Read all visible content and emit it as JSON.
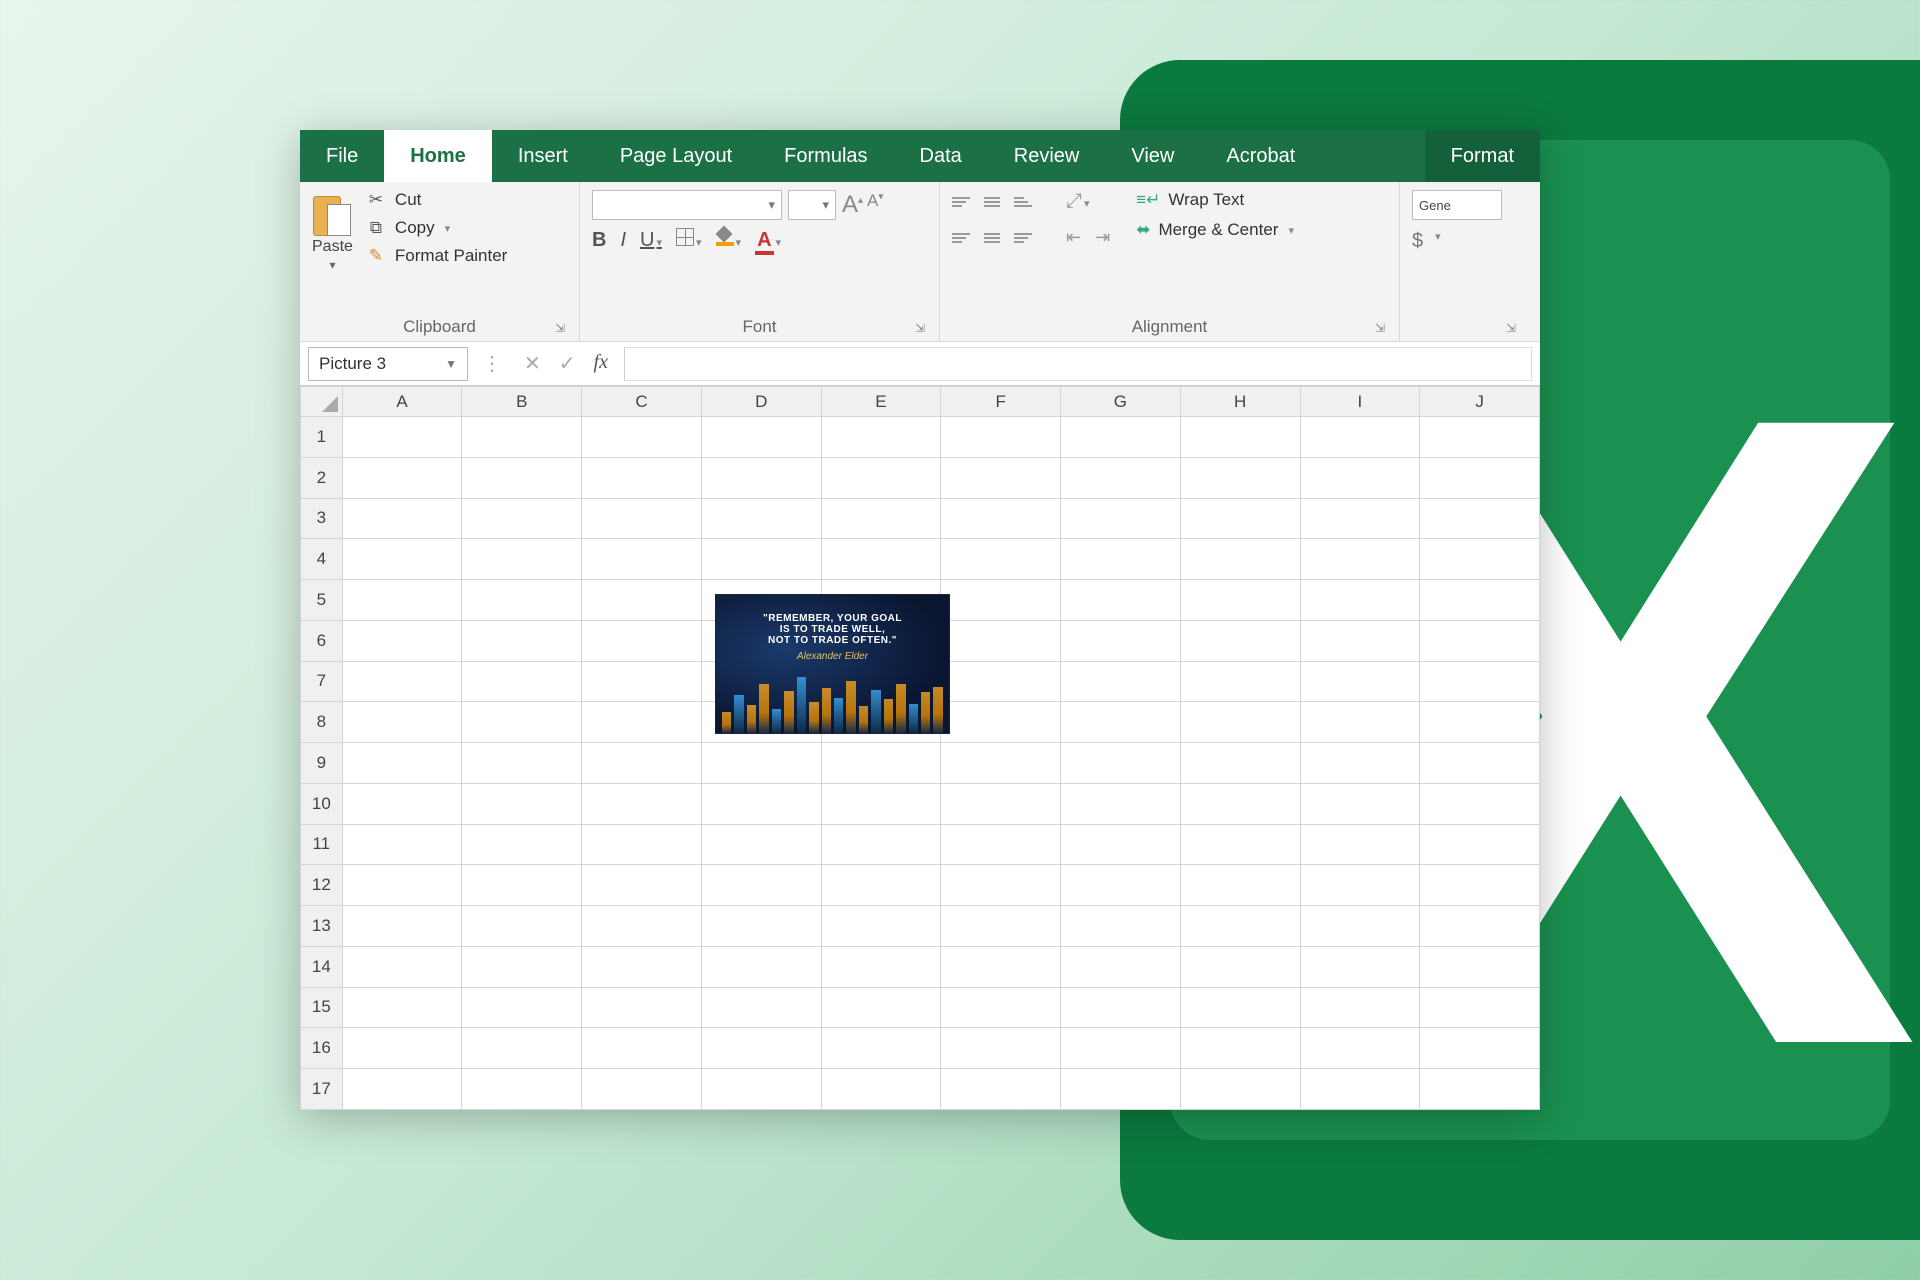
{
  "tabs": {
    "file": "File",
    "home": "Home",
    "insert": "Insert",
    "page_layout": "Page Layout",
    "formulas": "Formulas",
    "data": "Data",
    "review": "Review",
    "view": "View",
    "acrobat": "Acrobat",
    "format": "Format"
  },
  "ribbon": {
    "clipboard": {
      "label": "Clipboard",
      "paste": "Paste",
      "cut": "Cut",
      "copy": "Copy",
      "format_painter": "Format Painter"
    },
    "font": {
      "label": "Font",
      "bold": "B",
      "italic": "I",
      "underline": "U",
      "font_color_letter": "A"
    },
    "alignment": {
      "label": "Alignment",
      "wrap_text": "Wrap Text",
      "merge_center": "Merge & Center"
    },
    "number": {
      "general": "Gene",
      "currency": "$"
    }
  },
  "formula_bar": {
    "name_box": "Picture 3",
    "fx": "fx",
    "value": ""
  },
  "grid": {
    "columns": [
      "A",
      "B",
      "C",
      "D",
      "E",
      "F",
      "G",
      "H",
      "I",
      "J"
    ],
    "rows": [
      1,
      2,
      3,
      4,
      5,
      6,
      7,
      8,
      9,
      10,
      11,
      12,
      13,
      14,
      15,
      16,
      17
    ]
  },
  "picture": {
    "line1": "\"REMEMBER, YOUR GOAL",
    "line2": "IS TO TRADE WELL,",
    "line3": "NOT TO TRADE OFTEN.\"",
    "signature": "Alexander Elder"
  }
}
